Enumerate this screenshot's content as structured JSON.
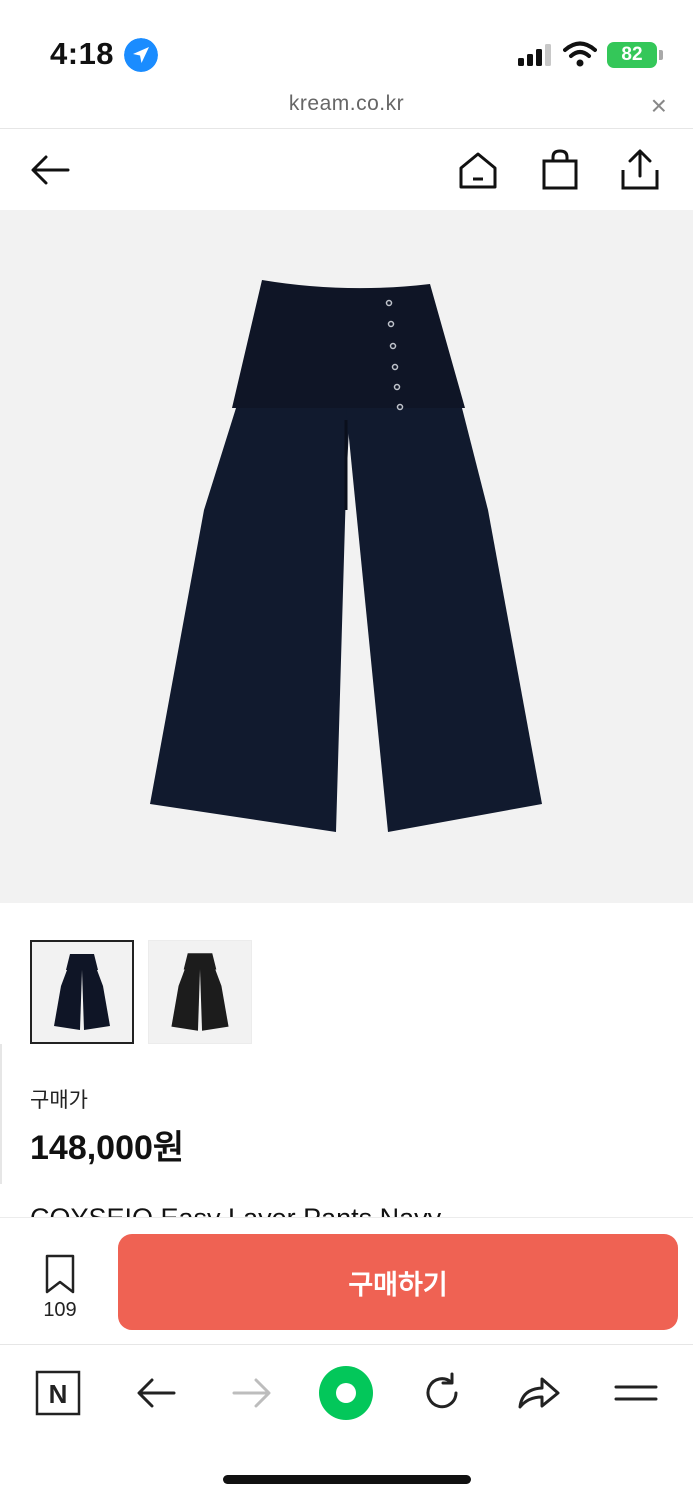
{
  "status_bar": {
    "time": "4:18",
    "battery": "82"
  },
  "url_bar": {
    "domain": "kream.co.kr",
    "close_label": "×"
  },
  "thumbnails": [
    {
      "alt": "navy",
      "color": "#0f1526"
    },
    {
      "alt": "black",
      "color": "#1c1c1c"
    }
  ],
  "product": {
    "price_label": "구매가",
    "price": "148,000원",
    "name": "COYSEIO Easy Layer Pants Navy",
    "main_color": "#0f1526"
  },
  "action_bar": {
    "wishlist_count": "109",
    "buy_label": "구매하기",
    "buy_color": "#ef6253"
  },
  "browser_toolbar": {
    "naver_label": "N",
    "accent": "#03c75a"
  }
}
